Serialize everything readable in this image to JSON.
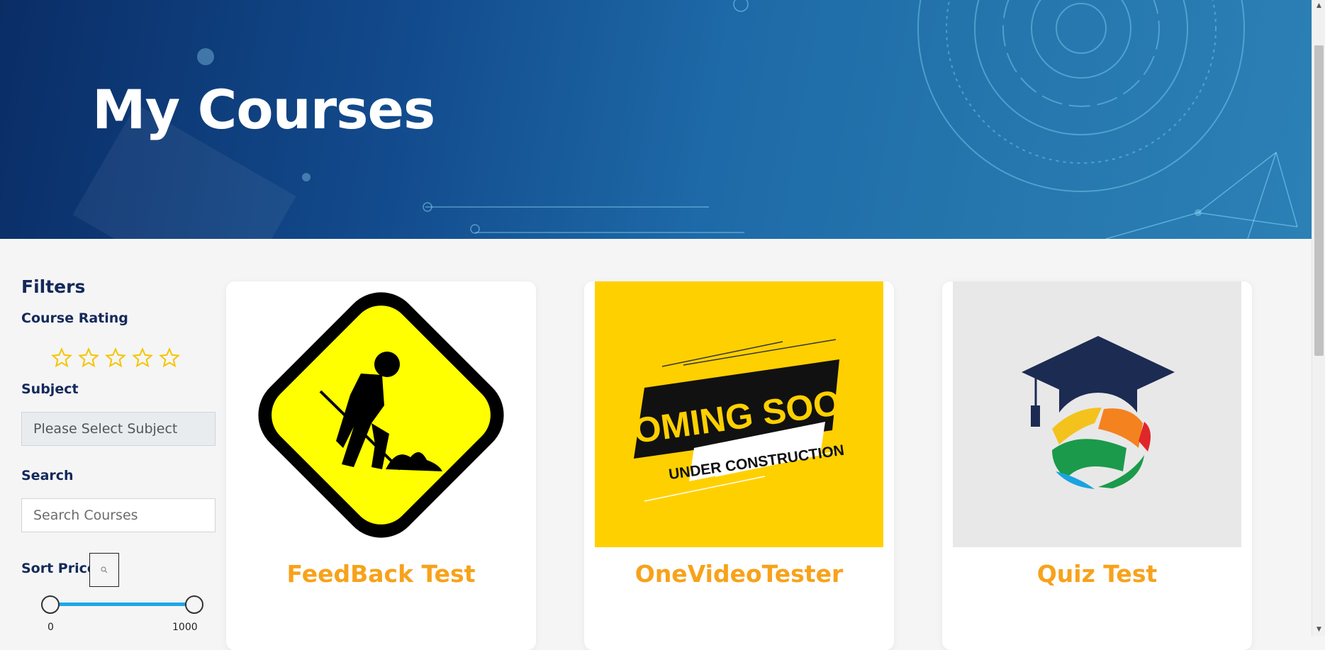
{
  "page": {
    "title": "My Courses"
  },
  "filters": {
    "title": "Filters",
    "course_rating_label": "Course Rating",
    "rating": {
      "value": 0,
      "max": 5
    },
    "subject_label": "Subject",
    "subject_value": "Please Select Subject",
    "search_label": "Search",
    "search_placeholder": "Search Courses",
    "sort_price_label": "Sort Price",
    "price_min": "0",
    "price_max": "1000"
  },
  "courses": [
    {
      "title": "FeedBack Test",
      "image_icon": "construction-worker-sign-icon"
    },
    {
      "title": "OneVideoTester",
      "image_icon": "coming-soon-banner",
      "banner_main": "COMING SOON",
      "banner_sub": "UNDER CONSTRUCTION"
    },
    {
      "title": "Quiz Test",
      "image_icon": "graduation-cap-globe-logo"
    }
  ],
  "colors": {
    "accent": "#f7a21b",
    "heading": "#14295a",
    "slider": "#1ea6e8",
    "star": "#f5c400"
  }
}
